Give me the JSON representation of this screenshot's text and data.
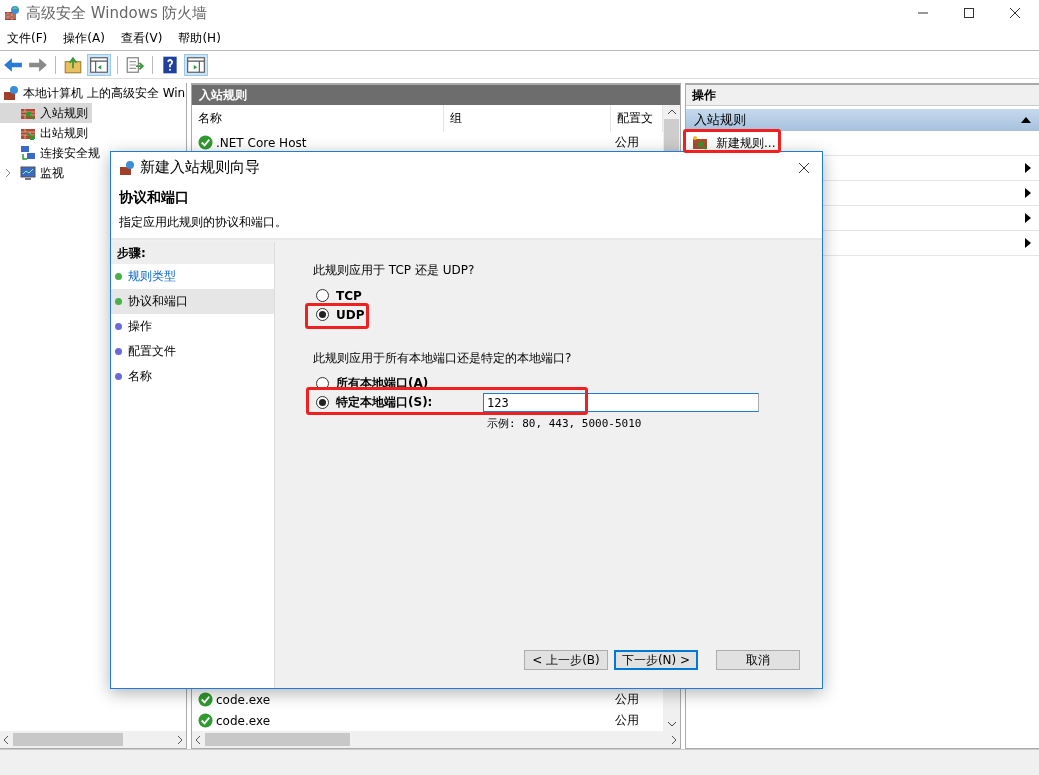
{
  "window": {
    "title": "高级安全 Windows 防火墙"
  },
  "menu": [
    "文件(F)",
    "操作(A)",
    "查看(V)",
    "帮助(H)"
  ],
  "tree": {
    "root": "本地计算机 上的高级安全 Win",
    "children": [
      {
        "label": "入站规则",
        "selected": true,
        "kind": "inbound"
      },
      {
        "label": "出站规则",
        "selected": false,
        "kind": "outbound"
      },
      {
        "label": "连接安全规",
        "selected": false,
        "kind": "connection"
      },
      {
        "label": "监视",
        "selected": false,
        "kind": "monitor",
        "expanded": false
      }
    ]
  },
  "table": {
    "title": "入站规则",
    "columns": [
      "名称",
      "组",
      "配置文"
    ],
    "rows": [
      {
        "name": ".NET Core Host",
        "group": "",
        "profile": "公用",
        "enabled": true
      },
      {
        "name": "code.exe",
        "group": "",
        "profile": "公用",
        "enabled": true
      },
      {
        "name": "code.exe",
        "group": "",
        "profile": "公用",
        "enabled": true
      }
    ]
  },
  "actions": {
    "title": "操作",
    "group": "入站规则",
    "items": [
      {
        "label": "新建规则..."
      }
    ]
  },
  "dialog": {
    "title": "新建入站规则向导",
    "heading": "协议和端口",
    "description": "指定应用此规则的协议和端口。",
    "steps_title": "步骤:",
    "steps": [
      {
        "label": "规则类型",
        "completed": true,
        "link": true,
        "selected": false
      },
      {
        "label": "协议和端口",
        "completed": true,
        "link": false,
        "selected": true
      },
      {
        "label": "操作",
        "completed": false,
        "link": false,
        "selected": false
      },
      {
        "label": "配置文件",
        "completed": false,
        "link": false,
        "selected": false
      },
      {
        "label": "名称",
        "completed": false,
        "link": false,
        "selected": false
      }
    ],
    "protocol_question": "此规则应用于 TCP 还是 UDP?",
    "protocols": [
      {
        "label": "TCP",
        "selected": false
      },
      {
        "label": "UDP",
        "selected": true
      }
    ],
    "port_question": "此规则应用于所有本地端口还是特定的本地端口?",
    "ports": [
      {
        "label": "所有本地端口(A)",
        "selected": false
      },
      {
        "label": "特定本地端口(S):",
        "selected": true
      }
    ],
    "port_value": "123",
    "port_hint": "示例: 80, 443, 5000-5010",
    "buttons": [
      {
        "label": "< 上一步(B)",
        "default": false
      },
      {
        "label": "下一步(N) >",
        "default": true
      },
      {
        "label": "取消",
        "default": false
      }
    ]
  }
}
